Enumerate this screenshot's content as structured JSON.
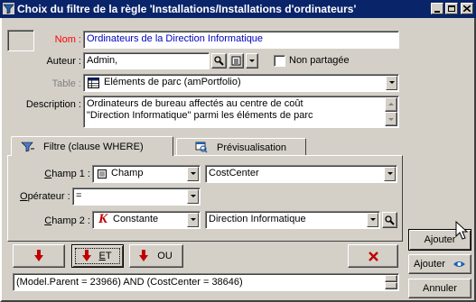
{
  "window": {
    "title": "Choix du filtre de la règle 'Installations/Installations d'ordinateurs'",
    "title_icon": "filter-window-icon",
    "controls": [
      "minimize-icon",
      "maximize-icon",
      "close-icon"
    ]
  },
  "form": {
    "name_label": "Nom :",
    "name_value": "Ordinateurs de la Direction Informatique",
    "author_label": "Auteur :",
    "author_value": "Admin,",
    "not_shared_label": "Non partagée",
    "not_shared_checked": false,
    "table_label": "Table :",
    "table_value": "Eléments de parc (amPortfolio)",
    "description_label": "Description :",
    "description_line1": "Ordinateurs de bureau affectés au centre de coût",
    "description_line2": "\"Direction Informatique\" parmi les éléments de parc"
  },
  "tabs": [
    {
      "label": "Filtre (clause WHERE)",
      "icon": "filter-icon",
      "active": true
    },
    {
      "label": "Prévisualisation",
      "icon": "preview-icon",
      "active": false
    }
  ],
  "filter": {
    "field1_label_pre": "C",
    "field1_label_post": "hamp 1 :",
    "field1_type": "Champ",
    "field1_type_icon": "field-icon",
    "field1_value": "CostCenter",
    "operator_label_pre": "O",
    "operator_label_post": "pérateur :",
    "operator_value": "=",
    "field2_label_pre": "C",
    "field2_label_post": "hamp 2 :",
    "field2_type": "Constante",
    "field2_type_icon": "constant-k-icon",
    "field2_value": "Direction Informatique",
    "and_label_pre": "E",
    "and_label_post": "T",
    "or_label": "OU",
    "clause": "(Model.Parent = 23966) AND (CostCenter = 38646)"
  },
  "buttons": {
    "add": "Ajouter",
    "add_and_label": "Ajouter",
    "cancel": "Annuler"
  },
  "colors": {
    "title_bar": "#0a246a",
    "required_label": "#ff0000",
    "disabled_text": "#808080",
    "arrow_red": "#c00000"
  }
}
